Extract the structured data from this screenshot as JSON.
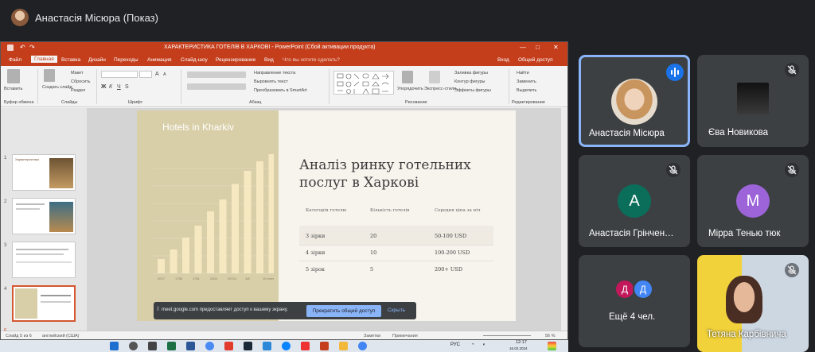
{
  "meet": {
    "presenter_title": "Анастасія Місюра (Показ)"
  },
  "ppt": {
    "title": "ХАРАКТЕРИСТИКА ГОТЕЛІВ В ХАРКОВІ - PowerPoint (Сбой активации продукта)",
    "window_controls": [
      "—",
      "□",
      "✕"
    ],
    "menu": [
      "Файл",
      "Главная",
      "Вставка",
      "Дизайн",
      "Переходы",
      "Анимация",
      "Слайд-шоу",
      "Рецензирование",
      "Вид",
      "Что вы хотите сделать?",
      "Вход",
      "Общий доступ"
    ],
    "ribbon": {
      "paste": "Вставить",
      "clipboard": "Буфер обмена",
      "new_slide": "Создать слайд",
      "layout": "Макет",
      "reset": "Сбросить",
      "section": "Раздел",
      "slides": "Слайды",
      "font": "Шрифт",
      "paragraph": "Абзац",
      "text_dir": "Направление текста",
      "align_text": "Выровнять текст",
      "smartart": "Преобразовать в SmartArt",
      "drawing": "Рисование",
      "arrange": "Упорядочить",
      "quick_styles": "Экспресс-стили",
      "fill": "Заливка фигуры",
      "outline": "Контур фигуры",
      "effects": "Эффекты фигуры",
      "find": "Найти",
      "replace": "Заменить",
      "select": "Выделить",
      "editing": "Редактирование",
      "font_bold": "Ж",
      "font_italic": "К",
      "font_underline": "Ч",
      "font_strike": "S",
      "font_grow": "A",
      "font_shrink": "A"
    },
    "thumbnails": [
      {
        "num": "1",
        "text": "Характеристика"
      },
      {
        "num": "2",
        "text": ""
      },
      {
        "num": "3",
        "text": ""
      },
      {
        "num": "4",
        "text": ""
      },
      {
        "num": "5",
        "text": ""
      }
    ],
    "slide": {
      "panel_title": "Hotels in Kharkiv",
      "heading": "Аналіз ринку готельних послуг в Харкові",
      "table_headers": [
        "Категорія готелю",
        "Кількість готелів",
        "Середня ціна за ніч"
      ],
      "table_rows": [
        [
          "3 зірки",
          "20",
          "50-100 USD"
        ],
        [
          "4 зірки",
          "10",
          "100-200 USD"
        ],
        [
          "5 зірок",
          "5",
          "200+ USD"
        ]
      ],
      "chart_bars": [
        0.12,
        0.2,
        0.3,
        0.4,
        0.52,
        0.62,
        0.75,
        0.86,
        0.94,
        1.0
      ],
      "chart_x_labels": [
        "2017",
        "1758",
        "1781",
        "2004",
        "20721",
        "1/8",
        "10 more"
      ]
    },
    "status": {
      "slide_info": "Слайд 5 из 6",
      "language": "английский (США)",
      "notes": "Заметки",
      "comments": "Примечания",
      "zoom": "56 %"
    },
    "thumb_bubble": "5"
  },
  "share_banner": {
    "text": "meet.google.com предоставляет доступ к вашему экрану.",
    "stop_label": "Прекратить общий доступ",
    "hide_label": "Скрыть"
  },
  "taskbar": {
    "lang": "РУС",
    "time": "12:17",
    "date": "16.02.2024"
  },
  "participants": [
    {
      "name": "Анастасія Місюра",
      "type": "photo",
      "speaking": true
    },
    {
      "name": "Єва Новикова",
      "type": "video",
      "muted": true
    },
    {
      "name": "Анастасія Грінчен…",
      "type": "letter",
      "letter": "А",
      "color": "#0b6e5a",
      "muted": true
    },
    {
      "name": "Мірра Тенью тюк",
      "type": "letter",
      "letter": "М",
      "color": "#9c64d8",
      "muted": true
    },
    {
      "name": "Ещё 4 чел.",
      "type": "group",
      "letters": [
        "Д",
        "Д"
      ]
    },
    {
      "name": "Тетяна Карбівнича",
      "type": "video",
      "muted": true
    }
  ],
  "colors": {
    "ppt_accent": "#c43e1c",
    "meet_bg": "#202124",
    "tile_bg": "#3c4043",
    "speaking_border": "#8ab4f8"
  }
}
